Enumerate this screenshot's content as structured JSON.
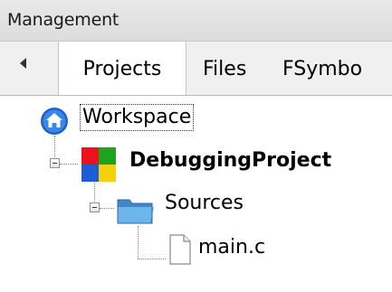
{
  "panel": {
    "title": "Management"
  },
  "tabs": [
    {
      "label": "Projects",
      "active": true
    },
    {
      "label": "Files",
      "active": false
    },
    {
      "label": "FSymbo",
      "active": false
    }
  ],
  "tree": {
    "workspace": {
      "label": "Workspace",
      "icon": "home-icon"
    },
    "project": {
      "label": "DebuggingProject",
      "icon": "project-icon"
    },
    "folder": {
      "label": "Sources",
      "icon": "folder-icon"
    },
    "file": {
      "label": "main.c",
      "icon": "file-icon"
    }
  },
  "colors": {
    "workspace_icon": "#2a6fd8",
    "folder_icon": "#5ba6e0",
    "project_red": "#e8131b",
    "project_green": "#1fa31f",
    "project_blue": "#1d5cd1",
    "project_yellow": "#f3d10c"
  }
}
